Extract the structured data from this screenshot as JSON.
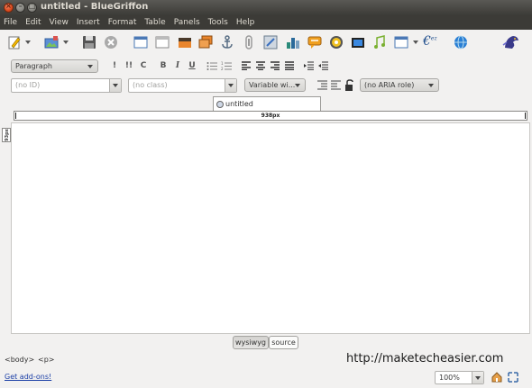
{
  "window": {
    "title": "untitled - BlueGriffon",
    "close_glyph": "×",
    "min_glyph": "–",
    "max_glyph": "□"
  },
  "menu": [
    "File",
    "Edit",
    "View",
    "Insert",
    "Format",
    "Table",
    "Panels",
    "Tools",
    "Help"
  ],
  "toolbar": {
    "icons": [
      "new-document-icon",
      "open-image-icon",
      "save-icon",
      "stop-icon",
      "layout-icon",
      "window-icon",
      "image-icon",
      "images-icon",
      "anchor-icon",
      "link-icon",
      "form-icon",
      "chart-icon",
      "comment-icon",
      "cd-icon",
      "video-icon",
      "audio-icon",
      "table-icon",
      "euro-icon",
      "globe-icon",
      "griffon-logo-icon"
    ],
    "euro_sup": "ez"
  },
  "format": {
    "paragraph_select": "Paragraph",
    "buttons": [
      "!",
      "!!",
      "C",
      "B",
      "I",
      "U"
    ]
  },
  "attributes": {
    "id_placeholder": "(no ID)",
    "class_placeholder": "(no class)",
    "width_select": "Variable wi...",
    "aria_select": "(no ARIA role)"
  },
  "document_tab": "untitled",
  "ruler": {
    "width_label": "938px",
    "vertical_label": "93px"
  },
  "modes": {
    "wysiwyg": "wysiwyg",
    "source": "source"
  },
  "breadcrumb": [
    "<body>",
    "<p>"
  ],
  "watermark": "http://maketecheasier.com",
  "status": {
    "addons": "Get add-ons!",
    "zoom": "100%"
  },
  "colors": {
    "titlebar": "#3c3b37",
    "panel": "#f2f1f0",
    "link": "#1a3ea6",
    "close_button": "#e0541c"
  }
}
